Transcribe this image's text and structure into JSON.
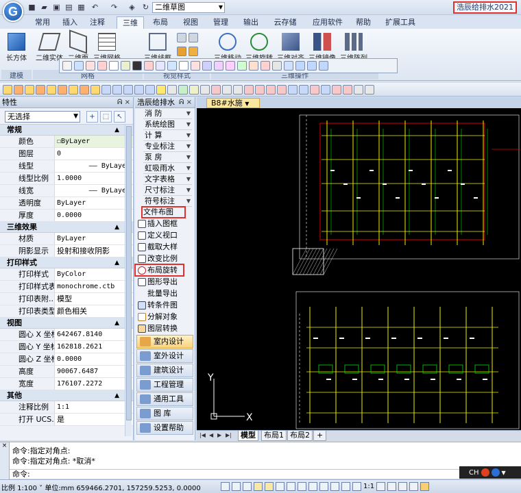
{
  "title_bar": {
    "document": "二维草图",
    "app_title": "浩辰给排水2021"
  },
  "ribbon": {
    "tabs": [
      "常用",
      "插入",
      "注释",
      "三维",
      "布局",
      "视图",
      "管理",
      "输出",
      "云存储",
      "应用软件",
      "帮助",
      "扩展工具"
    ],
    "active_tab": "三维",
    "big_buttons": [
      "长方体",
      "二维实体",
      "二维面",
      "三维网格",
      "三维线框",
      "三维移动",
      "三维旋转",
      "三维对齐",
      "三维镜像",
      "三维阵列"
    ],
    "groups": [
      "建模",
      "网格",
      "视觉样式",
      "三维操作"
    ]
  },
  "properties": {
    "title": "特性",
    "selection": "无选择",
    "sections": [
      {
        "name": "常规",
        "rows": [
          {
            "k": "颜色",
            "v": "ByLayer"
          },
          {
            "k": "图层",
            "v": "0"
          },
          {
            "k": "线型",
            "v": "ByLayer"
          },
          {
            "k": "线型比例",
            "v": "1.0000"
          },
          {
            "k": "线宽",
            "v": "ByLayer"
          },
          {
            "k": "透明度",
            "v": "ByLayer"
          },
          {
            "k": "厚度",
            "v": "0.0000"
          }
        ]
      },
      {
        "name": "三维效果",
        "rows": [
          {
            "k": "材质",
            "v": "ByLayer"
          },
          {
            "k": "阴影显示",
            "v": "投射和接收阴影"
          }
        ]
      },
      {
        "name": "打印样式",
        "rows": [
          {
            "k": "打印样式",
            "v": "ByColor"
          },
          {
            "k": "打印样式表",
            "v": "monochrome.ctb"
          },
          {
            "k": "打印表附...",
            "v": "模型"
          },
          {
            "k": "打印表类型",
            "v": "颜色相关"
          }
        ]
      },
      {
        "name": "视图",
        "rows": [
          {
            "k": "圆心 X 坐标",
            "v": "642467.8140"
          },
          {
            "k": "圆心 Y 坐标",
            "v": "162818.2621"
          },
          {
            "k": "圆心 Z 坐标",
            "v": "0.0000"
          },
          {
            "k": "高度",
            "v": "90067.6487"
          },
          {
            "k": "宽度",
            "v": "176107.2272"
          }
        ]
      },
      {
        "name": "其他",
        "rows": [
          {
            "k": "注释比例",
            "v": "1:1"
          },
          {
            "k": "打开 UCS...",
            "v": "是"
          }
        ]
      }
    ]
  },
  "plugin": {
    "title": "浩辰给排水",
    "menu": [
      "消 防",
      "系统绘图",
      "计 算",
      "专业标注",
      "泵 房",
      "虹吸雨水",
      "文字表格",
      "尺寸标注",
      "符号标注"
    ],
    "highlight_menu": "文件布图",
    "commands": [
      "插入图框",
      "定义视口",
      "截取大样",
      "改变比例",
      "布局旋转",
      "图形导出",
      "批量导出",
      "转条件图",
      "分解对象",
      "图层转换"
    ],
    "highlight_command": "布局旋转",
    "categories": [
      "室内设计",
      "室外设计",
      "建筑设计",
      "工程管理",
      "通用工具",
      "图 库",
      "设置帮助"
    ],
    "active_category": "室内设计"
  },
  "drawing": {
    "doc_tab": "B8#水施",
    "layout_tabs": [
      "模型",
      "布局1",
      "布局2"
    ],
    "active_layout": "模型",
    "axis_x": "X",
    "axis_y": "Y"
  },
  "command_line": {
    "lines": [
      "命令:指定对角点:",
      "命令:指定对角点: *取消*"
    ],
    "prompt": "命令:",
    "ime": "CH"
  },
  "status_bar": {
    "scale": "比例 1:100",
    "unit": "单位:mm",
    "coords": "659466.2701, 157259.5253, 0.0000",
    "annotation_scale": "1:1"
  },
  "colors": {
    "highlight_border": "#e0302b",
    "canvas_bg": "#000000",
    "cad_yellow": "#f0f000",
    "cad_green": "#00e000",
    "cad_red": "#e00000",
    "active_category": "#f9d27a"
  }
}
